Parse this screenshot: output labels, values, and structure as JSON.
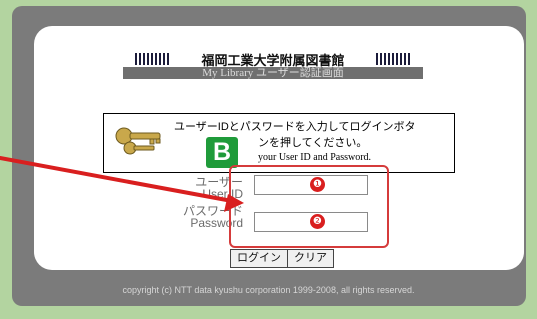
{
  "header": {
    "title": "福岡工業大学附属図書館",
    "subtitle": "My Library ユーザー認証画面"
  },
  "notice": {
    "line1": "ユーザーIDとパスワードを入力してログインボタ",
    "line2": "ンを押してください。",
    "line3": "your User ID and Password."
  },
  "badge": "B",
  "form": {
    "user_label_ja": "ユーザー",
    "user_label_en": "User ID",
    "pass_label_ja": "パスワード",
    "pass_label_en": "Password",
    "user_value": "",
    "pass_value": "",
    "user_marker": "❶",
    "pass_marker": "❷"
  },
  "buttons": {
    "login": "ログイン",
    "clear": "クリア"
  },
  "footer": {
    "copyright": "copyright (c) NTT data kyushu corporation 1999-2008, all rights reserved."
  },
  "colors": {
    "background": "#b8d9a6",
    "frame": "#7b7b7b",
    "badge": "#1f9b3a",
    "highlight": "#d53b3b"
  },
  "icons": [
    "key-icon",
    "red-arrow"
  ]
}
